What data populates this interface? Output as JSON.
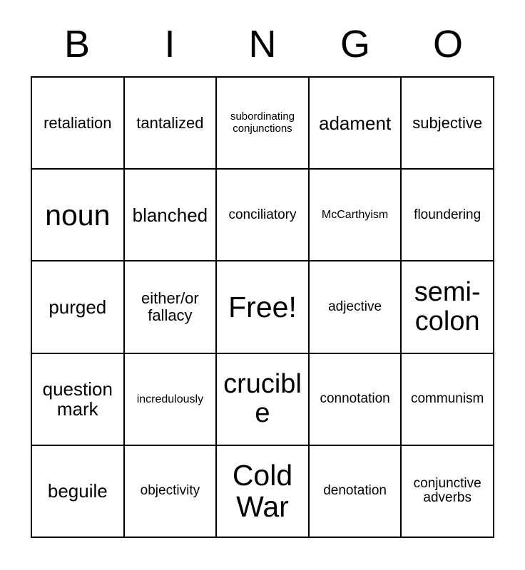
{
  "header": {
    "letters": [
      "B",
      "I",
      "N",
      "G",
      "O"
    ]
  },
  "grid": {
    "rows": 5,
    "columns": 5,
    "border_color": "#000000",
    "background_color": "#ffffff",
    "text_color": "#000000",
    "cells": [
      {
        "text": "retaliation",
        "size": "fs-lg"
      },
      {
        "text": "tantalized",
        "size": "fs-lg"
      },
      {
        "text": "subordinating conjunctions",
        "size": "fs-xs"
      },
      {
        "text": "adament",
        "size": "fs-xl"
      },
      {
        "text": "subjective",
        "size": "fs-lg"
      },
      {
        "text": "noun",
        "size": "fs-huge"
      },
      {
        "text": "blanched",
        "size": "fs-xl"
      },
      {
        "text": "conciliatory",
        "size": "fs-md"
      },
      {
        "text": "McCarthyism",
        "size": "fs-sm"
      },
      {
        "text": "floundering",
        "size": "fs-md"
      },
      {
        "text": "purged",
        "size": "fs-xl"
      },
      {
        "text": "either/or fallacy",
        "size": "fs-lg"
      },
      {
        "text": "Free!",
        "size": "fs-huge"
      },
      {
        "text": "adjective",
        "size": "fs-md"
      },
      {
        "text": "semi-colon",
        "size": "fs-xxl"
      },
      {
        "text": "question mark",
        "size": "fs-xl"
      },
      {
        "text": "incredulously",
        "size": "fs-sm"
      },
      {
        "text": "crucible",
        "size": "fs-xxl"
      },
      {
        "text": "connotation",
        "size": "fs-md"
      },
      {
        "text": "communism",
        "size": "fs-md"
      },
      {
        "text": "beguile",
        "size": "fs-xl"
      },
      {
        "text": "objectivity",
        "size": "fs-md"
      },
      {
        "text": "Cold War",
        "size": "fs-huge"
      },
      {
        "text": "denotation",
        "size": "fs-md"
      },
      {
        "text": "conjunctive adverbs",
        "size": "fs-md"
      }
    ]
  }
}
